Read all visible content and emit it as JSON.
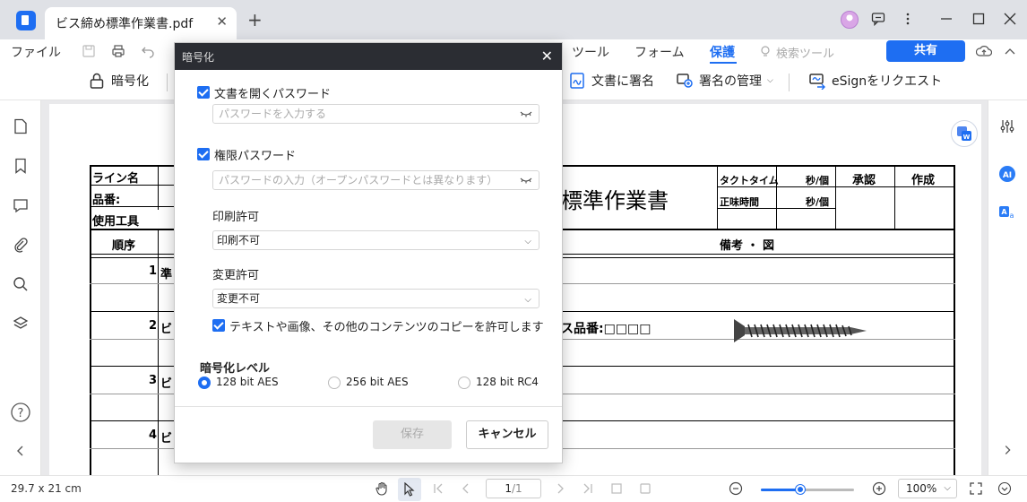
{
  "tab": {
    "title": "ビス締め標準作業書.pdf",
    "close": "✕",
    "new": "+"
  },
  "menu": {
    "file": "ファイル",
    "tool": "ツール",
    "form": "フォーム",
    "protect": "保護",
    "search_tool": "検索ツール",
    "share": "共有"
  },
  "toolbar": {
    "encrypt": "暗号化",
    "sign_doc": "文書に署名",
    "manage_sign": "署名の管理",
    "esign": "eSignをリクエスト"
  },
  "document": {
    "title": "標準作業書",
    "line_name": "ライン名",
    "product_no": "品番:",
    "tools_used": "使用工具",
    "order": "順序",
    "tact_time": "タクトタイム",
    "net_time": "正味時間",
    "sec_per_unit_1": "秒/個",
    "sec_per_unit_2": "秒/個",
    "approve": "承認",
    "create": "作成",
    "remarks": "備考 ・ 図",
    "steps": [
      "1",
      "2",
      "3",
      "4"
    ],
    "step1": "準",
    "step2": "ビ",
    "step3": "ビ",
    "step4": "ビ",
    "screw_part": "ス品番:□□□□"
  },
  "dialog": {
    "title": "暗号化",
    "close": "✕",
    "open_password_label": "文書を開くパスワード",
    "open_password_placeholder": "パスワードを入力する",
    "perm_password_label": "権限パスワード",
    "perm_password_placeholder": "パスワードの入力（オープンパスワードとは異なります）",
    "print_label": "印刷許可",
    "print_value": "印刷不可",
    "change_label": "変更許可",
    "change_value": "変更不可",
    "copy_label": "テキストや画像、その他のコンテンツのコピーを許可します",
    "level_label": "暗号化レベル",
    "levels": [
      "128 bit AES",
      "256 bit AES",
      "128 bit RC4"
    ],
    "selected_level": "128 bit AES",
    "save": "保存",
    "cancel": "キャンセル"
  },
  "status": {
    "page_size": "29.7 x 21 cm",
    "page_current": "1",
    "page_total": "/1",
    "zoom": "100%",
    "zoom_level": 0.42
  },
  "colors": {
    "accent": "#1e6ef2",
    "dialog_header": "#2b2d33"
  }
}
